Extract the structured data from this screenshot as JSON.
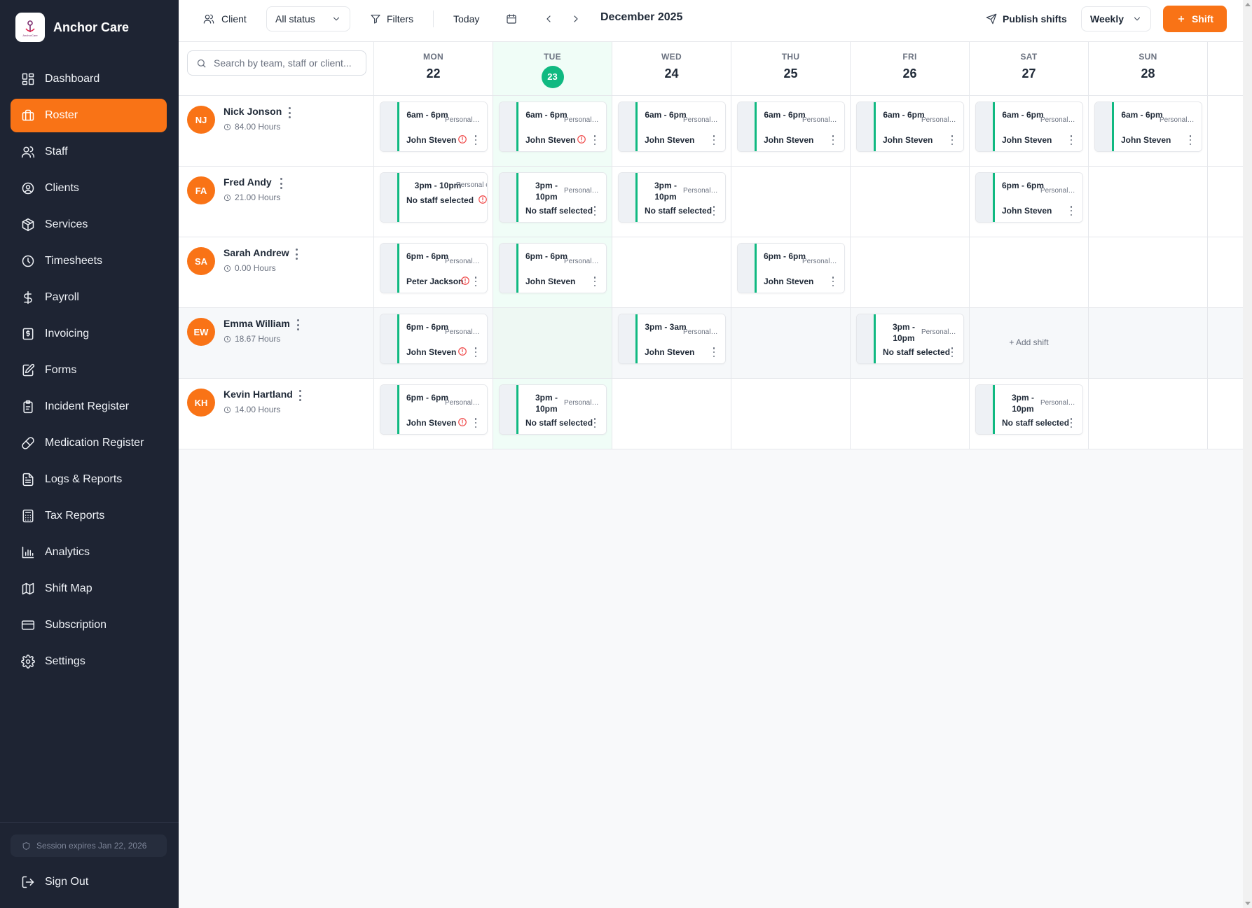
{
  "brand": {
    "name": "Anchor Care",
    "logo_text": "AnchorCare"
  },
  "sidebar": {
    "items": [
      {
        "label": "Dashboard",
        "icon": "grid-icon",
        "active": false
      },
      {
        "label": "Roster",
        "icon": "briefcase-icon",
        "active": true
      },
      {
        "label": "Staff",
        "icon": "users-icon",
        "active": false
      },
      {
        "label": "Clients",
        "icon": "user-circle-icon",
        "active": false
      },
      {
        "label": "Services",
        "icon": "box-icon",
        "active": false
      },
      {
        "label": "Timesheets",
        "icon": "clock-icon",
        "active": false
      },
      {
        "label": "Payroll",
        "icon": "dollar-icon",
        "active": false
      },
      {
        "label": "Invoicing",
        "icon": "invoice-icon",
        "active": false
      },
      {
        "label": "Forms",
        "icon": "form-edit-icon",
        "active": false
      },
      {
        "label": "Incident Register",
        "icon": "clipboard-icon",
        "active": false
      },
      {
        "label": "Medication Register",
        "icon": "pill-icon",
        "active": false
      },
      {
        "label": "Logs & Reports",
        "icon": "file-text-icon",
        "active": false
      },
      {
        "label": "Tax Reports",
        "icon": "calculator-icon",
        "active": false
      },
      {
        "label": "Analytics",
        "icon": "bar-chart-icon",
        "active": false
      },
      {
        "label": "Shift Map",
        "icon": "map-icon",
        "active": false
      },
      {
        "label": "Subscription",
        "icon": "credit-card-icon",
        "active": false
      },
      {
        "label": "Settings",
        "icon": "gear-icon",
        "active": false
      }
    ],
    "session": "Session expires Jan 22, 2026",
    "sign_out": "Sign Out"
  },
  "toolbar": {
    "client_label": "Client",
    "status_select": "All status",
    "filters_label": "Filters",
    "today_label": "Today",
    "month_label": "December 2025",
    "publish_label": "Publish shifts",
    "view_select": "Weekly",
    "add_shift_label": "Shift"
  },
  "search": {
    "placeholder": "Search by team, staff or client..."
  },
  "colors": {
    "accent": "#f97316",
    "today": "#10b981",
    "sidebar": "#1e2433",
    "shift_stripe": "#10b981",
    "warning": "#ef4444"
  },
  "days": [
    {
      "name": "MON",
      "num": "22",
      "today": false
    },
    {
      "name": "TUE",
      "num": "23",
      "today": true
    },
    {
      "name": "WED",
      "num": "24",
      "today": false
    },
    {
      "name": "THU",
      "num": "25",
      "today": false
    },
    {
      "name": "FRI",
      "num": "26",
      "today": false
    },
    {
      "name": "SAT",
      "num": "27",
      "today": false
    },
    {
      "name": "SUN",
      "num": "28",
      "today": false
    }
  ],
  "staff": [
    {
      "initials": "NJ",
      "name": "Nick Jonson",
      "hours": "84.00 Hours",
      "shifts": [
        {
          "time": "6am - 6pm",
          "type": "Personal ...",
          "staff": "John Steven",
          "warning": true
        },
        {
          "time": "6am - 6pm",
          "type": "Personal ...",
          "staff": "John Steven",
          "warning": true
        },
        {
          "time": "6am - 6pm",
          "type": "Personal ...",
          "staff": "John Steven",
          "warning": false
        },
        {
          "time": "6am - 6pm",
          "type": "Personal ...",
          "staff": "John Steven",
          "warning": false
        },
        {
          "time": "6am - 6pm",
          "type": "Personal ...",
          "staff": "John Steven",
          "warning": false
        },
        {
          "time": "6am - 6pm",
          "type": "Personal ...",
          "staff": "John Steven",
          "warning": false
        },
        {
          "time": "6am - 6pm",
          "type": "Personal ...",
          "staff": "John Steven",
          "warning": false
        }
      ]
    },
    {
      "initials": "FA",
      "name": "Fred Andy",
      "hours": "21.00 Hours",
      "shifts": [
        {
          "time": "3pm - 10pm",
          "type": "Personal c",
          "staff": "No staff selected",
          "warning": true,
          "oneline": true
        },
        {
          "time": "3pm - 10pm",
          "type": "Personal ...",
          "staff": "No staff selected",
          "warning": false
        },
        {
          "time": "3pm - 10pm",
          "type": "Personal ...",
          "staff": "No staff selected",
          "warning": false
        },
        null,
        null,
        {
          "time": "6pm - 6pm",
          "type": "Personal ...",
          "staff": "John Steven",
          "warning": false
        },
        null
      ]
    },
    {
      "initials": "SA",
      "name": "Sarah Andrew",
      "hours": "0.00 Hours",
      "shifts": [
        {
          "time": "6pm - 6pm",
          "type": "Personal c...",
          "staff": "Peter Jackson",
          "warning": true
        },
        {
          "time": "6pm - 6pm",
          "type": "Personal ...",
          "staff": "John Steven",
          "warning": false
        },
        null,
        {
          "time": "6pm - 6pm",
          "type": "Personal ...",
          "staff": "John Steven",
          "warning": false
        },
        null,
        null,
        null
      ]
    },
    {
      "initials": "EW",
      "name": "Emma William",
      "hours": "18.67 Hours",
      "highlight": true,
      "shifts": [
        {
          "time": "6pm - 6pm",
          "type": "Personal ...",
          "staff": "John Steven",
          "warning": true
        },
        null,
        {
          "time": "3pm - 3am",
          "type": "Personal ...",
          "staff": "John Steven",
          "warning": false
        },
        null,
        {
          "time": "3pm - 10pm",
          "type": "Personal ...",
          "staff": "No staff selected",
          "warning": false
        },
        "add",
        null
      ]
    },
    {
      "initials": "KH",
      "name": "Kevin Hartland",
      "hours": "14.00 Hours",
      "shifts": [
        {
          "time": "6pm - 6pm",
          "type": "Personal ...",
          "staff": "John Steven",
          "warning": true
        },
        {
          "time": "3pm - 10pm",
          "type": "Personal ...",
          "staff": "No staff selected",
          "warning": false
        },
        null,
        null,
        null,
        {
          "time": "3pm - 10pm",
          "type": "Personal ...",
          "staff": "No staff selected",
          "warning": false
        },
        null
      ]
    }
  ],
  "add_shift_label": "+ Add shift"
}
